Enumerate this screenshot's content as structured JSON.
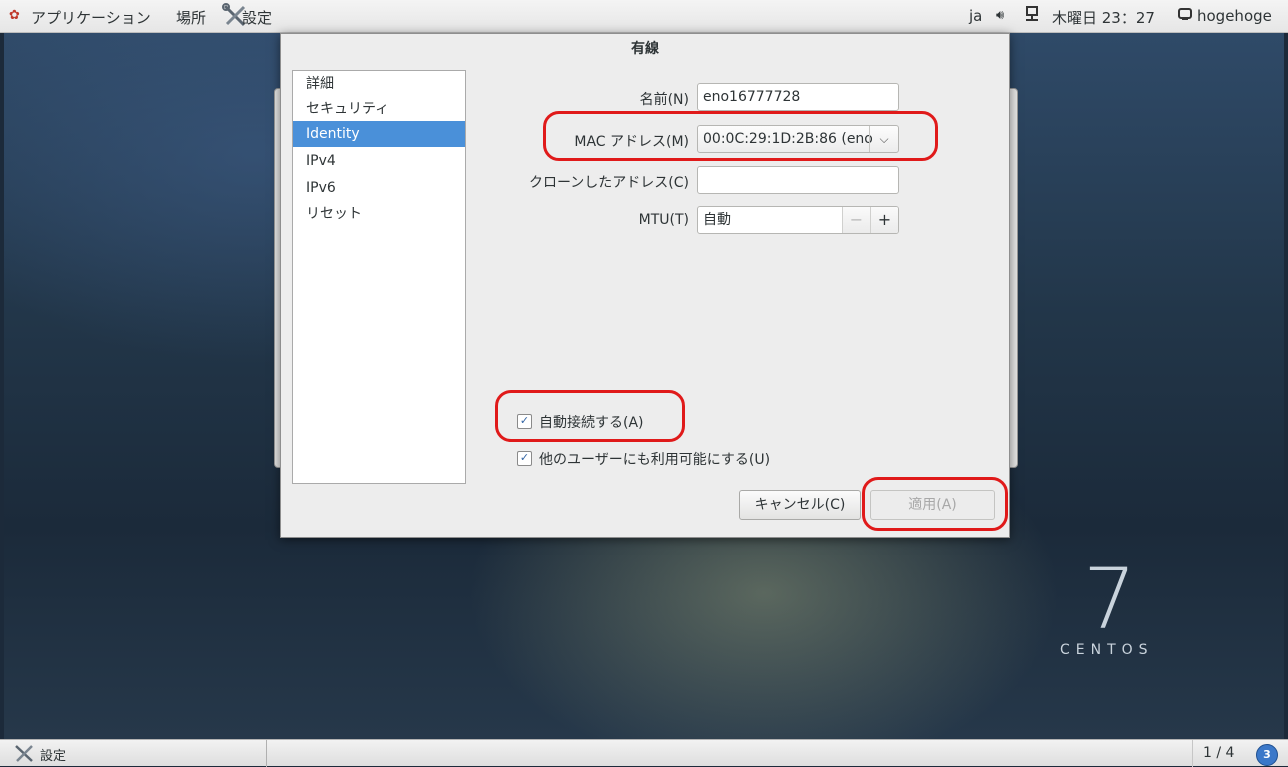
{
  "topbar": {
    "applications": "アプリケーション",
    "places": "場所",
    "app_name": "設定",
    "language": "ja",
    "clock": "木曜日 23：27",
    "user": "hogehoge"
  },
  "desktop": {
    "centos_number": "7",
    "centos_word": "CENTOS"
  },
  "dialog": {
    "title": "有線",
    "sidebar": {
      "items": [
        {
          "label": "詳細",
          "selected": false
        },
        {
          "label": "セキュリティ",
          "selected": false
        },
        {
          "label": "Identity",
          "selected": true
        },
        {
          "label": "IPv4",
          "selected": false
        },
        {
          "label": "IPv6",
          "selected": false
        },
        {
          "label": "リセット",
          "selected": false
        }
      ]
    },
    "name": {
      "label": "名前(N)",
      "value": "eno16777728"
    },
    "mac": {
      "label": "MAC アドレス(M)",
      "value": "00:0C:29:1D:2B:86 (eno"
    },
    "clone": {
      "label": "クローンしたアドレス(C)",
      "value": ""
    },
    "mtu": {
      "label": "MTU(T)",
      "value": "自動",
      "minus": "−",
      "plus": "+"
    },
    "autoconnect": {
      "label": "自動接続する(A)",
      "checked": true
    },
    "all_users": {
      "label": "他のユーザーにも利用可能にする(U)",
      "checked": true
    },
    "cancel_label": "キャンセル(C)",
    "apply_label": "適用(A)"
  },
  "bottombar": {
    "task_label": "設定",
    "workspace": "1 / 4",
    "workspace_badge": "3"
  },
  "colors": {
    "selection": "#4a90d9",
    "annotation": "#e01a1a"
  }
}
